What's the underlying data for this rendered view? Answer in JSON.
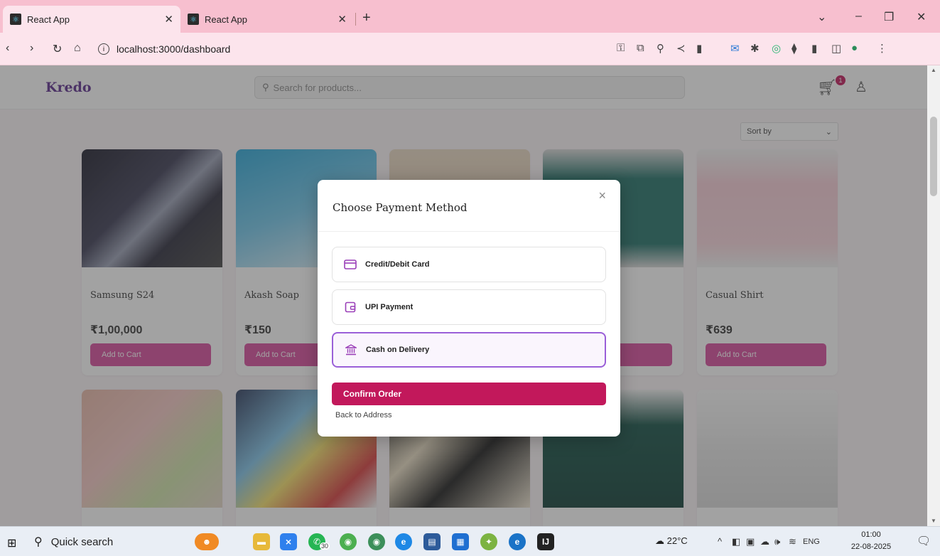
{
  "browser": {
    "tabs": [
      {
        "title": "React App"
      },
      {
        "title": "React App"
      }
    ],
    "new_tab": "+",
    "address": "localhost:3000/dashboard"
  },
  "app": {
    "brand": "Kredo",
    "search_placeholder": "Search for products...",
    "cart_count": "1",
    "sort_label": "Sort by"
  },
  "products": [
    {
      "name": "Samsung S24",
      "price": "₹1,00,000",
      "cta": "Add to Cart"
    },
    {
      "name": "Akash Soap",
      "price": "₹150",
      "cta": "Add to Cart"
    },
    {
      "name": "",
      "price": "",
      "cta": ""
    },
    {
      "name": "",
      "price": "",
      "cta": ""
    },
    {
      "name": "Casual Shirt",
      "price": "₹639",
      "cta": "Add to Cart"
    }
  ],
  "modal": {
    "title": "Choose Payment Method",
    "close": "×",
    "options": [
      {
        "label": "Credit/Debit Card",
        "icon": "credit-card-icon",
        "selected": false
      },
      {
        "label": "UPI Payment",
        "icon": "wallet-icon",
        "selected": false
      },
      {
        "label": "Cash on Delivery",
        "icon": "bank-icon",
        "selected": true
      }
    ],
    "confirm": "Confirm Order",
    "back": "Back to Address"
  },
  "taskbar": {
    "search": "Quick search",
    "whatsapp_badge": "30",
    "weather": "22°C",
    "lang": "ENG",
    "time": "01:00",
    "date": "22-08-2025"
  },
  "colors": {
    "tab_strip": "#f7bfcf",
    "primary": "#c2185b",
    "selected_border": "#9a5fd8",
    "brand": "#5a2b8c",
    "add_to_cart": "#d64a9c"
  }
}
